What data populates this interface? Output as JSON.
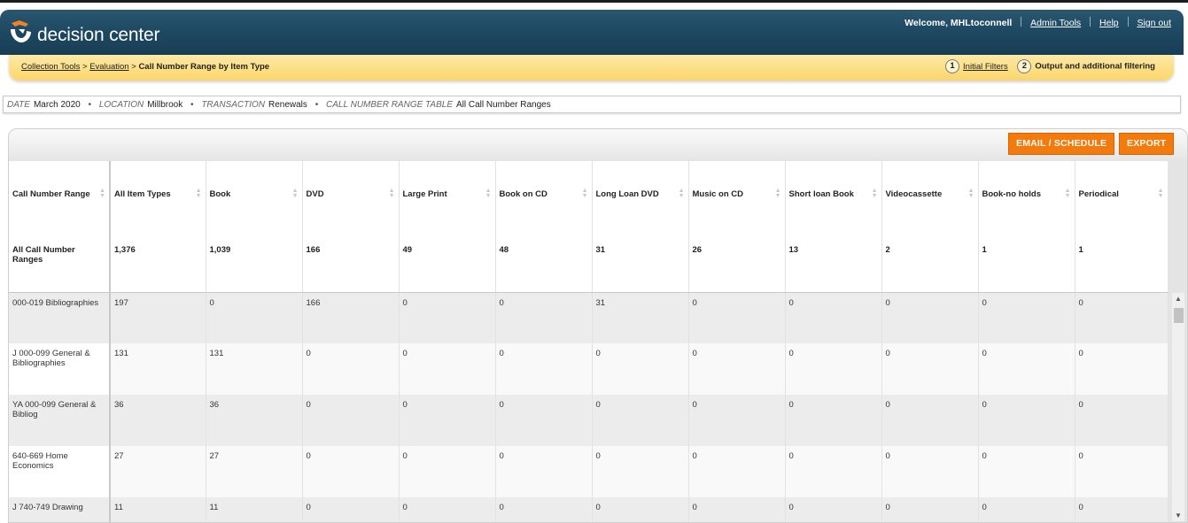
{
  "app": {
    "brand": "decision center"
  },
  "user_nav": {
    "welcome": "Welcome, MHLtoconnell",
    "admin_tools": "Admin Tools",
    "help": "Help",
    "sign_out": "Sign out"
  },
  "breadcrumb": {
    "items": [
      "Collection Tools",
      "Evaluation"
    ],
    "separator": ">",
    "current": "Call Number Range by Item Type"
  },
  "steps": [
    {
      "num": "1",
      "label": "Initial Filters"
    },
    {
      "num": "2",
      "label": "Output and additional filtering"
    }
  ],
  "filters": [
    {
      "label": "DATE",
      "value": "March 2020"
    },
    {
      "label": "LOCATION",
      "value": "Millbrook"
    },
    {
      "label": "TRANSACTION",
      "value": "Renewals"
    },
    {
      "label": "CALL NUMBER RANGE TABLE",
      "value": "All Call Number Ranges"
    }
  ],
  "filter_separator": "•",
  "actions": {
    "email": "EMAIL / SCHEDULE",
    "export": "EXPORT"
  },
  "table": {
    "columns": [
      "Call Number Range",
      "All Item Types",
      "Book",
      "DVD",
      "Large Print",
      "Book on CD",
      "Long Loan DVD",
      "Music on CD",
      "Short loan Book",
      "Videocassette",
      "Book-no holds",
      "Periodical"
    ],
    "total_row": [
      "All Call Number Ranges",
      "1,376",
      "1,039",
      "166",
      "49",
      "48",
      "31",
      "26",
      "13",
      "2",
      "1",
      "1"
    ],
    "rows": [
      [
        "000-019 Bibliographies",
        "197",
        "0",
        "166",
        "0",
        "0",
        "31",
        "0",
        "0",
        "0",
        "0",
        "0"
      ],
      [
        "J 000-099 General & Bibliographies",
        "131",
        "131",
        "0",
        "0",
        "0",
        "0",
        "0",
        "0",
        "0",
        "0",
        "0"
      ],
      [
        "YA 000-099 General & Bibliog",
        "36",
        "36",
        "0",
        "0",
        "0",
        "0",
        "0",
        "0",
        "0",
        "0",
        "0"
      ],
      [
        "640-669 Home Economics",
        "27",
        "27",
        "0",
        "0",
        "0",
        "0",
        "0",
        "0",
        "0",
        "0",
        "0"
      ],
      [
        "J 740-749 Drawing",
        "11",
        "11",
        "0",
        "0",
        "0",
        "0",
        "0",
        "0",
        "0",
        "0",
        "0"
      ]
    ]
  },
  "colors": {
    "header": "#1d4760",
    "breadcrumb_bar": "#fbd66b",
    "button": "#f37a0c"
  }
}
